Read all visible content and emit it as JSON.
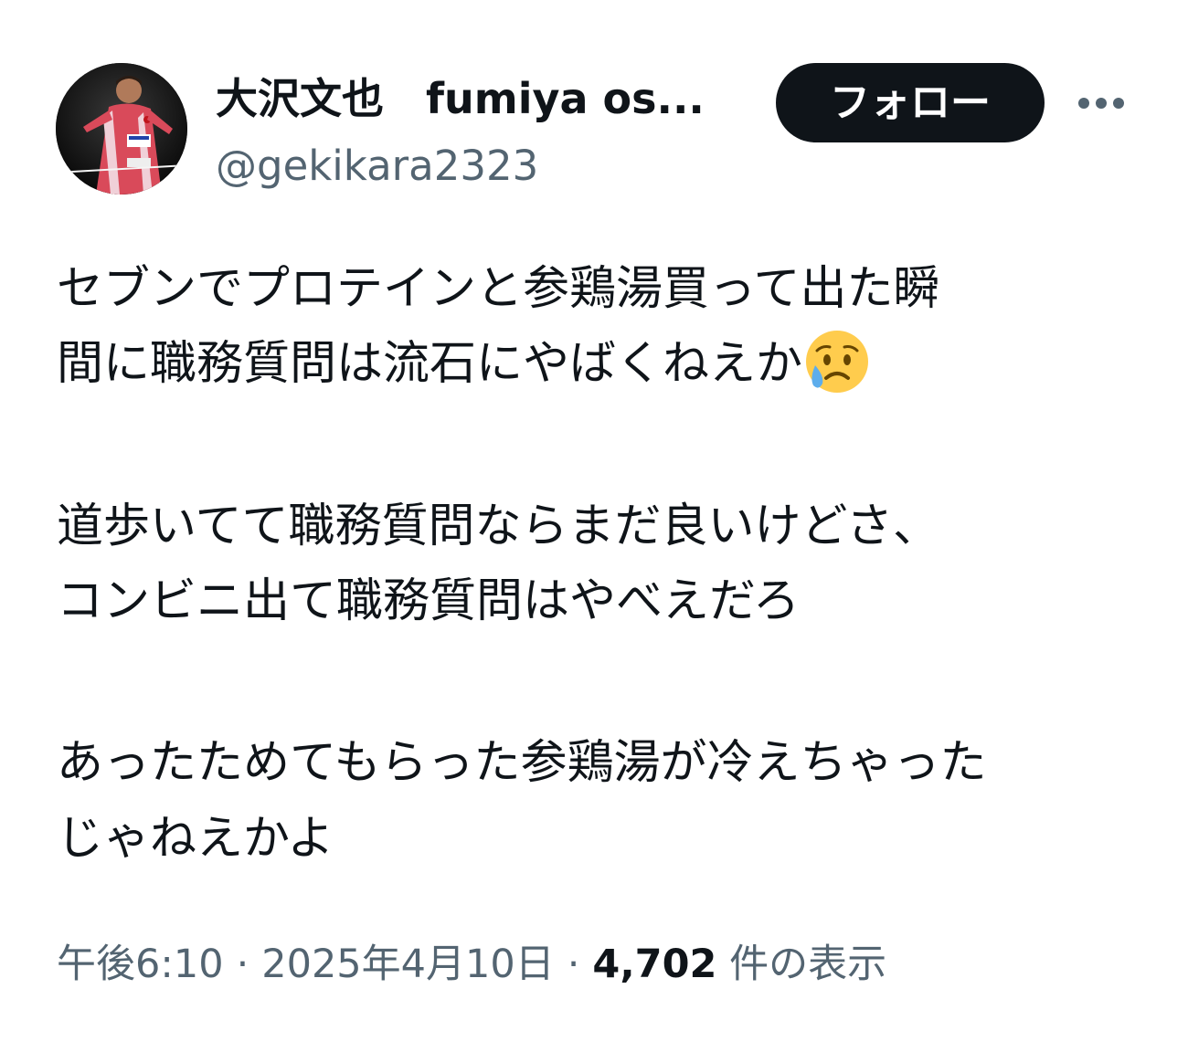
{
  "header": {
    "display_name": "大沢文也　fumiya os...",
    "handle": "@gekikara2323",
    "follow_label": "フォロー",
    "more_icon": "more-horizontal-icon"
  },
  "tweet": {
    "lines": [
      "セブンでプロテインと参鶏湯買って出た瞬",
      "間に職務質問は流石にやばくねえか",
      "道歩いてて職務質問ならまだ良いけどさ、",
      "コンビニ出て職務質問はやべえだろ",
      "あったためてもらった参鶏湯が冷えちゃった",
      "じゃねえかよ"
    ],
    "emoji": "sad-but-relieved-face-emoji"
  },
  "meta": {
    "time": "午後6:10",
    "separator": "·",
    "date": "2025年4月10日",
    "views_count": "4,702",
    "views_label": "件の表示"
  }
}
